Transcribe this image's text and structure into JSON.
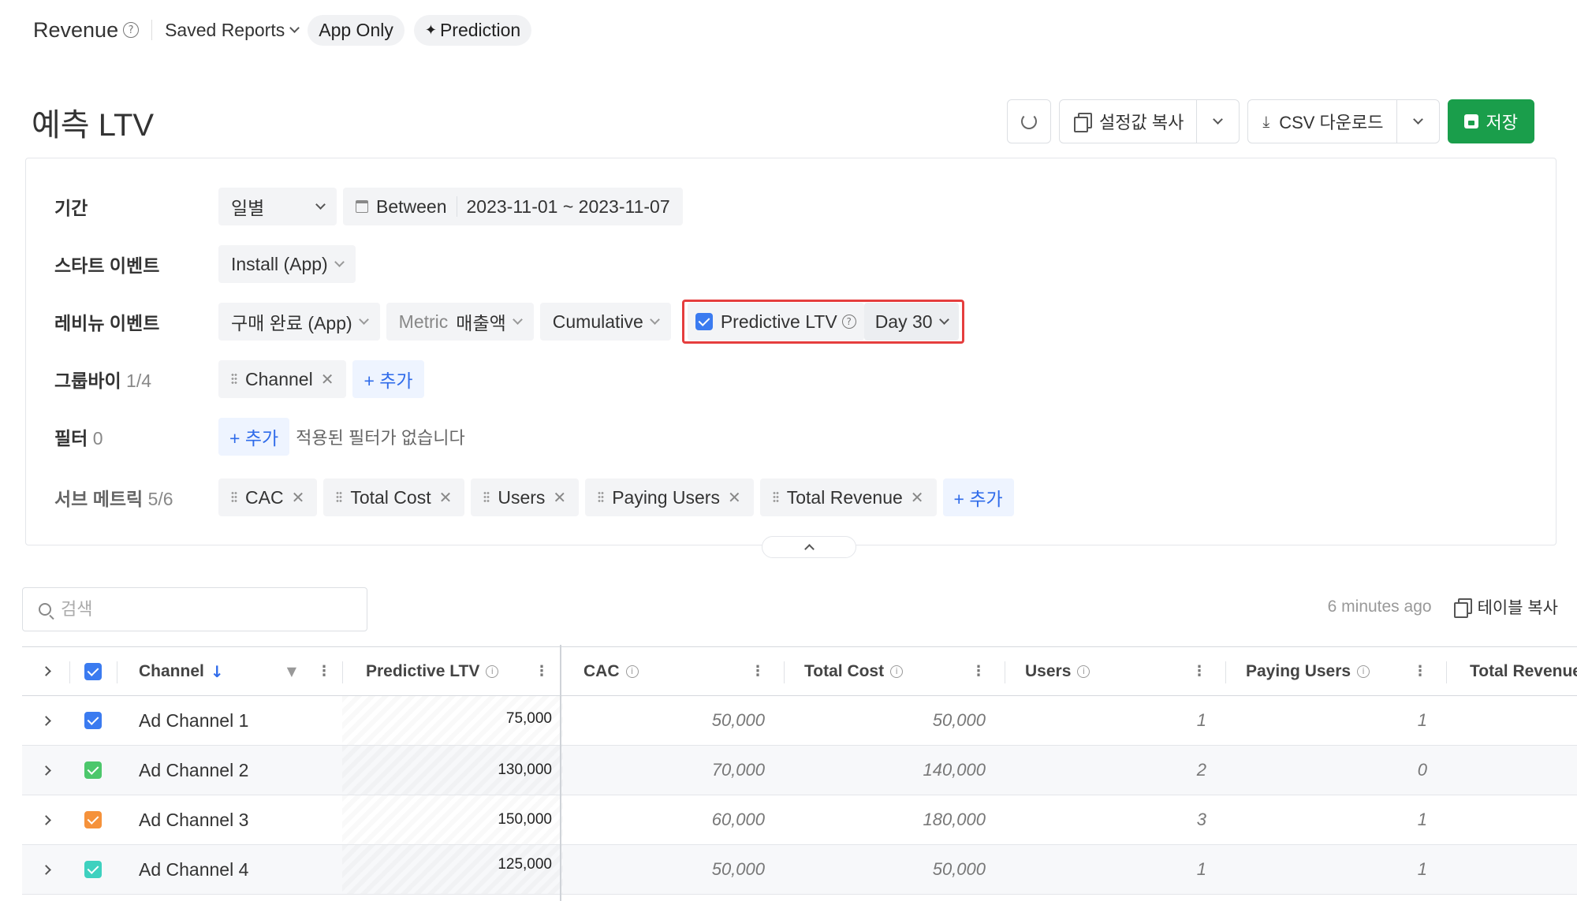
{
  "topbar": {
    "title": "Revenue",
    "help": "?",
    "saved_reports": "Saved Reports",
    "pill_app_only": "App Only",
    "pill_prediction": "Prediction"
  },
  "page": {
    "title": "예측 LTV"
  },
  "actions": {
    "copy_settings": "설정값 복사",
    "csv_download": "CSV 다운로드",
    "save": "저장"
  },
  "settings": {
    "period": {
      "label": "기간",
      "granularity": "일별",
      "mode": "Between",
      "range": "2023-11-01  ~  2023-11-07"
    },
    "start_event": {
      "label": "스타트 이벤트",
      "value": "Install (App)"
    },
    "revenue_event": {
      "label": "레비뉴 이벤트",
      "event": "구매 완료 (App)",
      "metric_label": "Metric",
      "metric_value": "매출액",
      "aggregation": "Cumulative",
      "predictive_ltv": "Predictive LTV",
      "predictive_help": "?",
      "day": "Day 30"
    },
    "groupby": {
      "label": "그룹바이",
      "count": "1/4",
      "chips": [
        "Channel"
      ],
      "add": "+ 추가"
    },
    "filter": {
      "label": "필터",
      "count": "0",
      "add": "+ 추가",
      "empty_note": "적용된 필터가 없습니다"
    },
    "sub_metrics": {
      "label": "서브 메트릭",
      "count": "5/6",
      "chips": [
        "CAC",
        "Total Cost",
        "Users",
        "Paying Users",
        "Total Revenue"
      ],
      "add": "+ 추가"
    }
  },
  "search": {
    "placeholder": "검색"
  },
  "meta": {
    "updated": "6 minutes ago",
    "copy_table": "테이블 복사"
  },
  "table": {
    "headers": {
      "channel": "Channel",
      "sort": "↓",
      "predictive_ltv": "Predictive LTV",
      "cac": "CAC",
      "total_cost": "Total Cost",
      "users": "Users",
      "paying_users": "Paying Users",
      "total_revenue": "Total Revenue"
    },
    "info": "i",
    "rows": [
      {
        "channel": "Ad Channel 1",
        "color": "#3b7bf0",
        "predictive_ltv": "75,000",
        "cac": "50,000",
        "total_cost": "50,000",
        "users": "1",
        "paying_users": "1"
      },
      {
        "channel": "Ad Channel 2",
        "color": "#4cc76b",
        "predictive_ltv": "130,000",
        "cac": "70,000",
        "total_cost": "140,000",
        "users": "2",
        "paying_users": "0"
      },
      {
        "channel": "Ad Channel 3",
        "color": "#f5923b",
        "predictive_ltv": "150,000",
        "cac": "60,000",
        "total_cost": "180,000",
        "users": "3",
        "paying_users": "1"
      },
      {
        "channel": "Ad Channel 4",
        "color": "#3ed1bf",
        "predictive_ltv": "125,000",
        "cac": "50,000",
        "total_cost": "50,000",
        "users": "1",
        "paying_users": "1"
      }
    ]
  },
  "colors": {
    "accent": "#2f6bea",
    "save_green": "#1a9e4b",
    "highlight_red": "#e53e3e"
  }
}
